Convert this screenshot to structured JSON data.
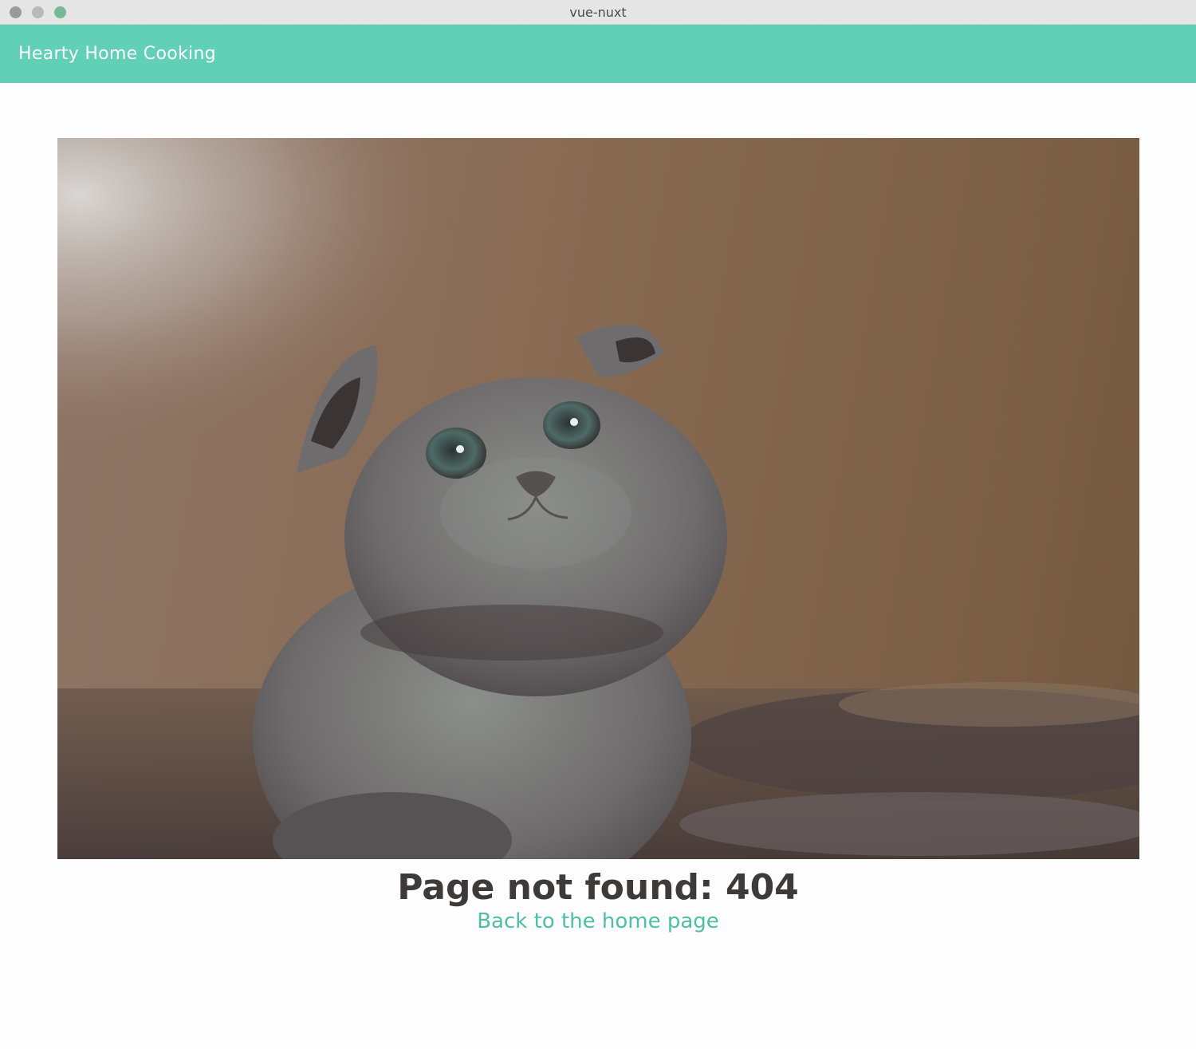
{
  "window": {
    "title": "vue-nuxt"
  },
  "header": {
    "brand": "Hearty Home Cooking"
  },
  "main": {
    "image_alt": "Kitten",
    "error_title": "Page not found: 404",
    "back_link": "Back to the home page"
  },
  "colors": {
    "header_bg": "#62cfb7",
    "link": "#4ebfa6",
    "heading": "#3f3a3a"
  }
}
